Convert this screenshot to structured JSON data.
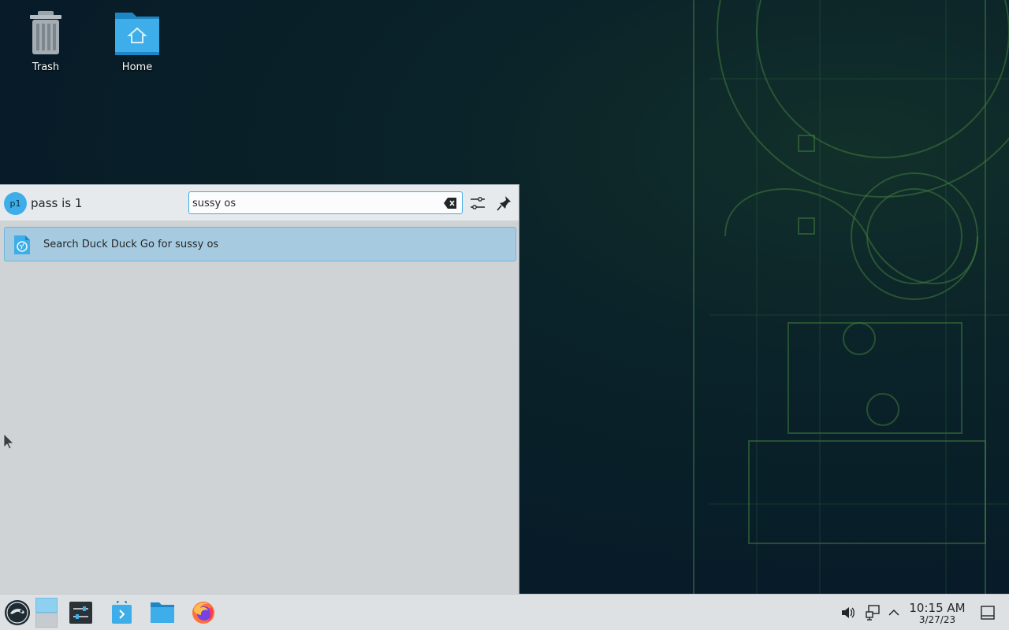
{
  "desktop": {
    "icons": [
      {
        "label": "Trash",
        "icon": "trash-icon"
      },
      {
        "label": "Home",
        "icon": "home-folder-icon"
      }
    ]
  },
  "launcher": {
    "avatar_text": "p1",
    "user_name": "pass is 1",
    "search_value": "sussy os",
    "clear_icon": "clear-text-icon",
    "filter_icon": "configure-icon",
    "pin_icon": "pin-icon",
    "results": [
      {
        "label": "Search Duck Duck Go for sussy os",
        "icon": "web-search-icon"
      }
    ]
  },
  "taskbar": {
    "launcher_icon": "opensuse-logo-icon",
    "pager_icon": "virtual-desktop-pager-icon",
    "apps": [
      {
        "name": "system-settings",
        "icon": "settings-app-icon"
      },
      {
        "name": "discover",
        "icon": "discover-app-icon"
      },
      {
        "name": "dolphin",
        "icon": "file-manager-icon"
      },
      {
        "name": "firefox",
        "icon": "firefox-icon"
      }
    ],
    "tray": [
      "volume-icon",
      "network-icon",
      "expand-tray-icon"
    ],
    "clock_time": "10:15 AM",
    "clock_date": "3/27/23",
    "show_desktop_icon": "show-desktop-icon"
  },
  "colors": {
    "accent": "#3daee9",
    "selection": "#a6cbe0",
    "panel": "#dde1e4",
    "wallpaper": "#071c28"
  }
}
